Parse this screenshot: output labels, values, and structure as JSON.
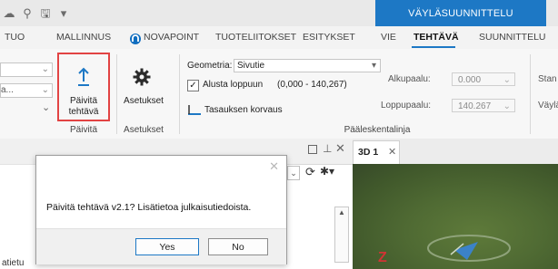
{
  "titlebar": {
    "context_tab": "VÄYLÄSUUNNITTELU",
    "dropdown_glyph": "▾"
  },
  "tabs": [
    {
      "label": "TUO"
    },
    {
      "label": "MALLINNUS"
    },
    {
      "label": "NOVAPOINT"
    },
    {
      "label": "TUOTELIITOKSET"
    },
    {
      "label": "ESITYKSET"
    },
    {
      "label": "VIE"
    },
    {
      "label": "TEHTÄVÄ",
      "active": true
    },
    {
      "label": "SUUNNITTELU"
    }
  ],
  "ribbon": {
    "left_combo1": "",
    "left_combo2": "a...",
    "update_task": {
      "line1": "Päivitä",
      "line2": "tehtävä"
    },
    "settings_label": "Asetukset",
    "group_update": "Päivitä",
    "group_settings": "Asetukset",
    "geometry_label": "Geometria:",
    "geometry_value": "Sivutie",
    "alusta_loppuun": "Alusta loppuun",
    "range_text": "(0,000 - 140,267)",
    "tasauksen_korvaus": "Tasauksen korvaus",
    "alkupaalu_label": "Alkupaalu:",
    "alkupaalu_value": "0.000",
    "loppupaalu_label": "Loppupaalu:",
    "loppupaalu_value": "140.267",
    "group_main": "Pääleskentalinja",
    "right_cut1": "Stan",
    "right_cut2": "Väylä"
  },
  "panel": {
    "bottom_text": "atietu"
  },
  "view3d": {
    "tab_label": "3D 1",
    "axis_label": "Z"
  },
  "dialog": {
    "message": "Päivitä tehtävä v2.1? Lisätietoa julkaisutiedoista.",
    "yes": "Yes",
    "no": "No"
  },
  "colors": {
    "accent": "#1d78c5",
    "highlight": "#e24343",
    "terrain": "#4f6a33"
  }
}
